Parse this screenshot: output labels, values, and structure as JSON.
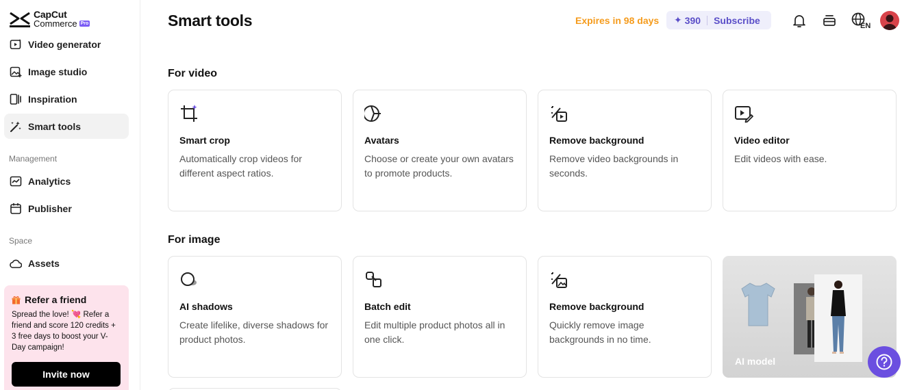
{
  "brand": {
    "line1": "CapCut",
    "line2": "Commerce",
    "badge": "Pro"
  },
  "sidebar": {
    "items": [
      {
        "label": "Video generator",
        "icon": "video-generator-icon"
      },
      {
        "label": "Image studio",
        "icon": "image-studio-icon"
      },
      {
        "label": "Inspiration",
        "icon": "inspiration-icon"
      },
      {
        "label": "Smart tools",
        "icon": "magic-wand-icon",
        "active": true
      }
    ],
    "management_label": "Management",
    "management": [
      {
        "label": "Analytics",
        "icon": "chart-icon"
      },
      {
        "label": "Publisher",
        "icon": "calendar-icon"
      }
    ],
    "space_label": "Space",
    "space": [
      {
        "label": "Assets",
        "icon": "cloud-icon"
      }
    ],
    "refer": {
      "title": "Refer a friend",
      "body_1": "Spread the love!",
      "body_2": "Refer a friend and score 120 credits + 3 free days to boost your V-Day campaign!",
      "button": "Invite now"
    }
  },
  "header": {
    "title": "Smart tools",
    "expires": "Expires in 98 days",
    "credits": "390",
    "subscribe": "Subscribe",
    "language": "EN"
  },
  "sections": {
    "video": {
      "title": "For video",
      "cards": [
        {
          "title": "Smart crop",
          "desc": "Automatically crop videos for different aspect ratios.",
          "icon": "crop-icon"
        },
        {
          "title": "Avatars",
          "desc": "Choose or create your own avatars to promote products.",
          "icon": "avatar-face-icon"
        },
        {
          "title": "Remove background",
          "desc": "Remove video backgrounds in seconds.",
          "icon": "remove-bg-video-icon"
        },
        {
          "title": "Video editor",
          "desc": "Edit videos with ease.",
          "icon": "video-edit-icon"
        }
      ]
    },
    "image": {
      "title": "For image",
      "cards": [
        {
          "title": "AI shadows",
          "desc": "Create lifelike, diverse shadows for product photos.",
          "icon": "shadow-icon"
        },
        {
          "title": "Batch edit",
          "desc": "Edit multiple product photos all in one click.",
          "icon": "batch-edit-icon"
        },
        {
          "title": "Remove background",
          "desc": "Quickly remove image backgrounds in no time.",
          "icon": "remove-bg-image-icon"
        }
      ],
      "ai_model_label": "AI model"
    }
  },
  "colors": {
    "accent": "#6b4fe0",
    "expires": "#f59b1c",
    "credits_text": "#5a4ec8",
    "refer_bg": "#fde3ec"
  }
}
